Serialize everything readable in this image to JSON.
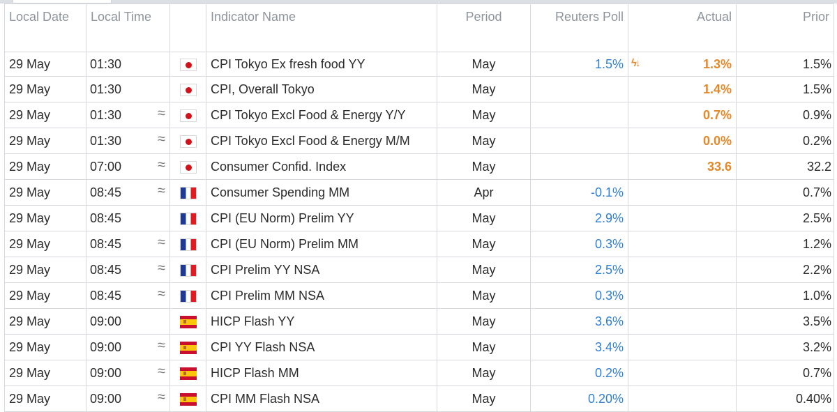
{
  "columns": {
    "local_date": "Local Date",
    "local_time": "Local Time",
    "flag": "",
    "indicator_name": "Indicator Name",
    "period": "Period",
    "reuters_poll": "Reuters Poll",
    "actual": "Actual",
    "prior": "Prior"
  },
  "colors": {
    "poll_blue": "#2f7fd4",
    "actual_orange": "#e4882a",
    "header_gray": "#8e949b",
    "grid_line": "#d5d8dc"
  },
  "rows": [
    {
      "date": "29 May",
      "time": "01:30",
      "approx": false,
      "flag": "jp-flag-icon",
      "indicator": "CPI Tokyo Ex fresh food YY",
      "period": "May",
      "poll": "1.5%",
      "actual": "1.3%",
      "flash": true,
      "prior": "1.5%"
    },
    {
      "date": "29 May",
      "time": "01:30",
      "approx": false,
      "flag": "jp-flag-icon",
      "indicator": "CPI, Overall Tokyo",
      "period": "May",
      "poll": "",
      "actual": "1.4%",
      "flash": false,
      "prior": "1.5%"
    },
    {
      "date": "29 May",
      "time": "01:30",
      "approx": true,
      "flag": "jp-flag-icon",
      "indicator": "CPI Tokyo Excl Food & Energy Y/Y",
      "period": "May",
      "poll": "",
      "actual": "0.7%",
      "flash": false,
      "prior": "0.9%"
    },
    {
      "date": "29 May",
      "time": "01:30",
      "approx": true,
      "flag": "jp-flag-icon",
      "indicator": "CPI Tokyo Excl Food & Energy M/M",
      "period": "May",
      "poll": "",
      "actual": "0.0%",
      "flash": false,
      "prior": "0.2%"
    },
    {
      "date": "29 May",
      "time": "07:00",
      "approx": true,
      "flag": "jp-flag-icon",
      "indicator": "Consumer Confid. Index",
      "period": "May",
      "poll": "",
      "actual": "33.6",
      "flash": false,
      "prior": "32.2"
    },
    {
      "date": "29 May",
      "time": "08:45",
      "approx": true,
      "flag": "fr-flag-icon",
      "indicator": "Consumer Spending MM",
      "period": "Apr",
      "poll": "-0.1%",
      "actual": "",
      "flash": false,
      "prior": "0.7%"
    },
    {
      "date": "29 May",
      "time": "08:45",
      "approx": false,
      "flag": "fr-flag-icon",
      "indicator": "CPI (EU Norm) Prelim YY",
      "period": "May",
      "poll": "2.9%",
      "actual": "",
      "flash": false,
      "prior": "2.5%"
    },
    {
      "date": "29 May",
      "time": "08:45",
      "approx": true,
      "flag": "fr-flag-icon",
      "indicator": "CPI (EU Norm) Prelim MM",
      "period": "May",
      "poll": "0.3%",
      "actual": "",
      "flash": false,
      "prior": "1.2%"
    },
    {
      "date": "29 May",
      "time": "08:45",
      "approx": true,
      "flag": "fr-flag-icon",
      "indicator": "CPI Prelim YY NSA",
      "period": "May",
      "poll": "2.5%",
      "actual": "",
      "flash": false,
      "prior": "2.2%"
    },
    {
      "date": "29 May",
      "time": "08:45",
      "approx": true,
      "flag": "fr-flag-icon",
      "indicator": "CPI Prelim MM NSA",
      "period": "May",
      "poll": "0.3%",
      "actual": "",
      "flash": false,
      "prior": "1.0%"
    },
    {
      "date": "29 May",
      "time": "09:00",
      "approx": false,
      "flag": "es-flag-icon",
      "indicator": "HICP Flash YY",
      "period": "May",
      "poll": "3.6%",
      "actual": "",
      "flash": false,
      "prior": "3.5%"
    },
    {
      "date": "29 May",
      "time": "09:00",
      "approx": true,
      "flag": "es-flag-icon",
      "indicator": "CPI YY Flash NSA",
      "period": "May",
      "poll": "3.4%",
      "actual": "",
      "flash": false,
      "prior": "3.2%"
    },
    {
      "date": "29 May",
      "time": "09:00",
      "approx": true,
      "flag": "es-flag-icon",
      "indicator": "HICP Flash MM",
      "period": "May",
      "poll": "0.2%",
      "actual": "",
      "flash": false,
      "prior": "0.7%"
    },
    {
      "date": "29 May",
      "time": "09:00",
      "approx": true,
      "flag": "es-flag-icon",
      "indicator": "CPI MM Flash NSA",
      "period": "May",
      "poll": "0.20%",
      "actual": "",
      "flash": false,
      "prior": "0.40%"
    }
  ]
}
